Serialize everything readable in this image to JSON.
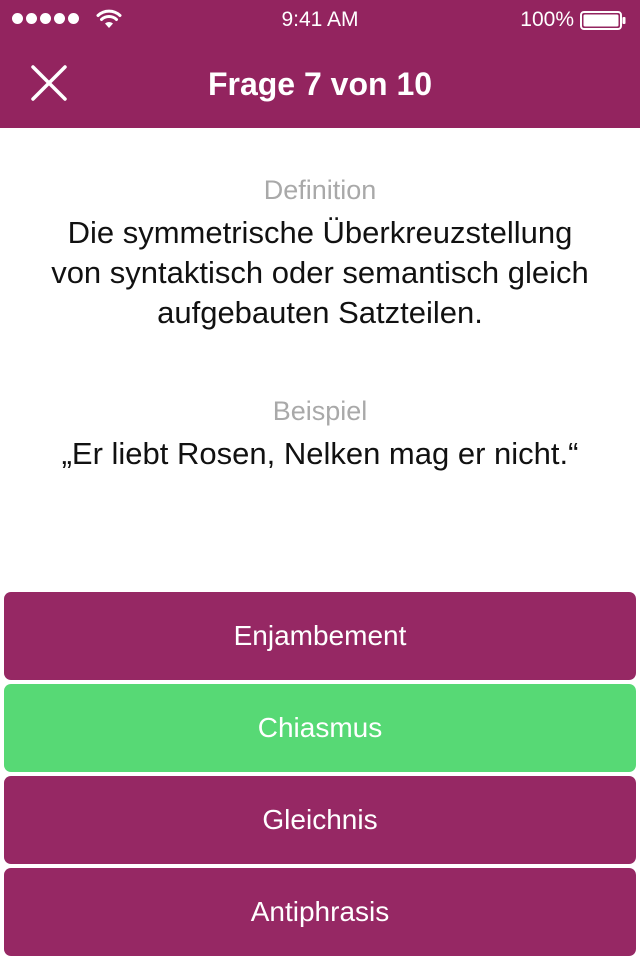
{
  "status": {
    "time": "9:41 AM",
    "battery": "100%",
    "signal_icon": "signal-dots-icon",
    "wifi_icon": "wifi-icon",
    "battery_icon": "battery-icon"
  },
  "nav": {
    "close_icon": "close-icon",
    "title": "Frage 7 von 10"
  },
  "question": {
    "definition_label": "Definition",
    "definition_text": "Die symmetrische Überkreuzstellung von syntaktisch oder semantisch gleich aufgebauten Satzteilen.",
    "example_label": "Beispiel",
    "example_text": "„Er liebt Rosen, Nelken mag er nicht.“"
  },
  "answers": [
    {
      "label": "Enjambement",
      "state": "default"
    },
    {
      "label": "Chiasmus",
      "state": "correct"
    },
    {
      "label": "Gleichnis",
      "state": "default"
    },
    {
      "label": "Antiphrasis",
      "state": "default"
    }
  ],
  "colors": {
    "brand": "#93245f",
    "answer_default": "#962864",
    "answer_correct": "#57d975",
    "label_gray": "#a9a9a9"
  }
}
